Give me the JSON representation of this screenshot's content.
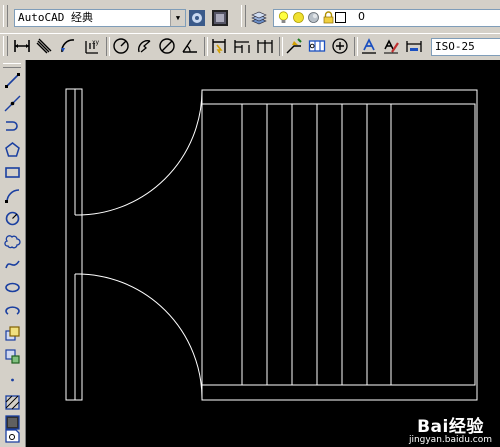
{
  "workspace": {
    "selected": "AutoCAD 经典"
  },
  "layer": {
    "current": "0"
  },
  "dimstyle": {
    "selected": "ISO-25"
  },
  "watermark": {
    "brand": "Bai经验",
    "url": "jingyan.baidu.com"
  },
  "icons": {
    "toolbar1": [
      "workspace-settings-icon",
      "workspace-toolbar-icon",
      "layer-manager-icon",
      "lightbulb-on-icon",
      "sun-freeze-icon",
      "layer-lock-icon",
      "layer-color-icon"
    ],
    "toolbar2": [
      "linear-dimension-icon",
      "aligned-dimension-icon",
      "arc-length-icon",
      "ordinate-dimension-icon",
      "radius-dimension-icon",
      "jogged-dimension-icon",
      "diameter-dimension-icon",
      "angular-dimension-icon",
      "quick-dimension-icon",
      "baseline-dimension-icon",
      "continue-dimension-icon",
      "quick-leader-icon",
      "tolerance-icon",
      "center-mark-icon",
      "dimension-edit-icon",
      "dimension-text-edit-icon",
      "dimension-update-icon"
    ],
    "draw": [
      "line-icon",
      "construction-line-icon",
      "polyline-icon",
      "polygon-icon",
      "rectangle-icon",
      "arc-icon",
      "circle-icon",
      "revision-cloud-icon",
      "spline-icon",
      "ellipse-icon",
      "ellipse-arc-icon",
      "insert-block-icon",
      "make-block-icon",
      "point-icon",
      "hatch-icon",
      "gradient-icon",
      "region-icon"
    ]
  },
  "colors": {
    "panel": "#d4d0c8",
    "canvas": "#000000",
    "drawing": "#ffffff"
  }
}
